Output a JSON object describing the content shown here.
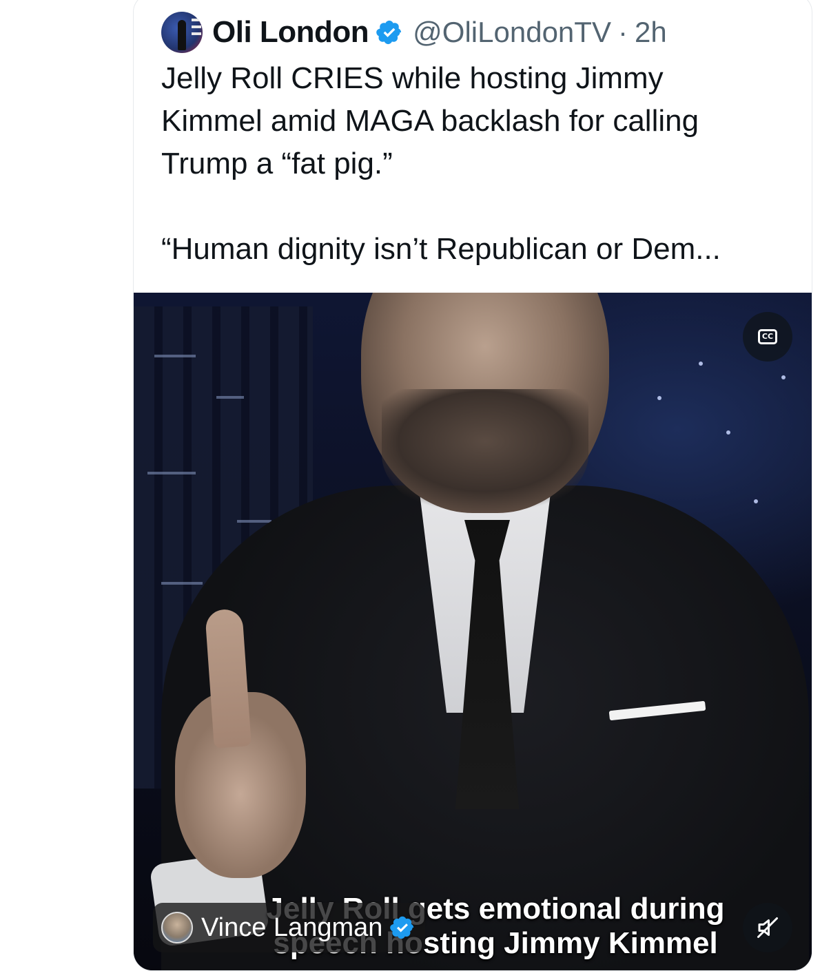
{
  "tweet": {
    "author": {
      "name": "Oli London",
      "handle": "@OliLondonTV",
      "separator": "·",
      "time": "2h",
      "verified_color": "#1d9bf0"
    },
    "text": "Jelly Roll CRIES while hosting Jimmy\nKimmel amid MAGA backlash for calling\nTrump a “fat pig.”\n\n“Human dignity isn’t Republican or Dem..."
  },
  "media": {
    "type": "video",
    "caption": "Jelly Roll gets emotional during\nspeech hosting Jimmy Kimmel",
    "cc_icon": "closed-captions-icon",
    "cc_label": "CC",
    "mute_icon": "speaker-muted-icon",
    "tagged_user": {
      "name": "Vince Langman",
      "verified_color": "#1d9bf0"
    }
  }
}
